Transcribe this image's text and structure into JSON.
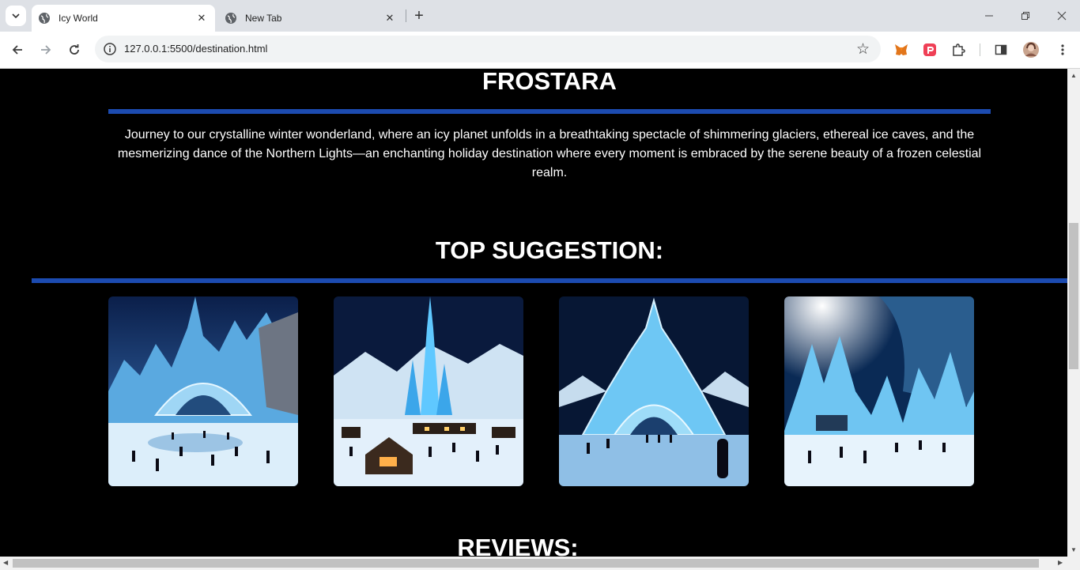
{
  "browser": {
    "tabs": [
      {
        "label": "Icy World",
        "active": true
      },
      {
        "label": "New Tab",
        "active": false
      }
    ],
    "url": "127.0.0.1:5500/destination.html"
  },
  "page": {
    "destination_title": "FROSTARA",
    "description": "Journey to our crystalline winter wonderland, where an icy planet unfolds in a breathtaking spectacle of shimmering glaciers, ethereal ice caves, and the mesmerizing dance of the Northern Lights—an enchanting holiday destination where every moment is embraced by the serene beauty of a frozen celestial realm.",
    "suggestion_heading": "TOP SUGGESTION:",
    "reviews_heading": "REVIEWS:",
    "accent_color": "#1c4bb0",
    "suggestions": [
      {
        "image": "ice-palace-skating-rink"
      },
      {
        "image": "ice-castle-village-night"
      },
      {
        "image": "ice-arch-cathedral"
      },
      {
        "image": "ice-cave-skating"
      }
    ]
  }
}
